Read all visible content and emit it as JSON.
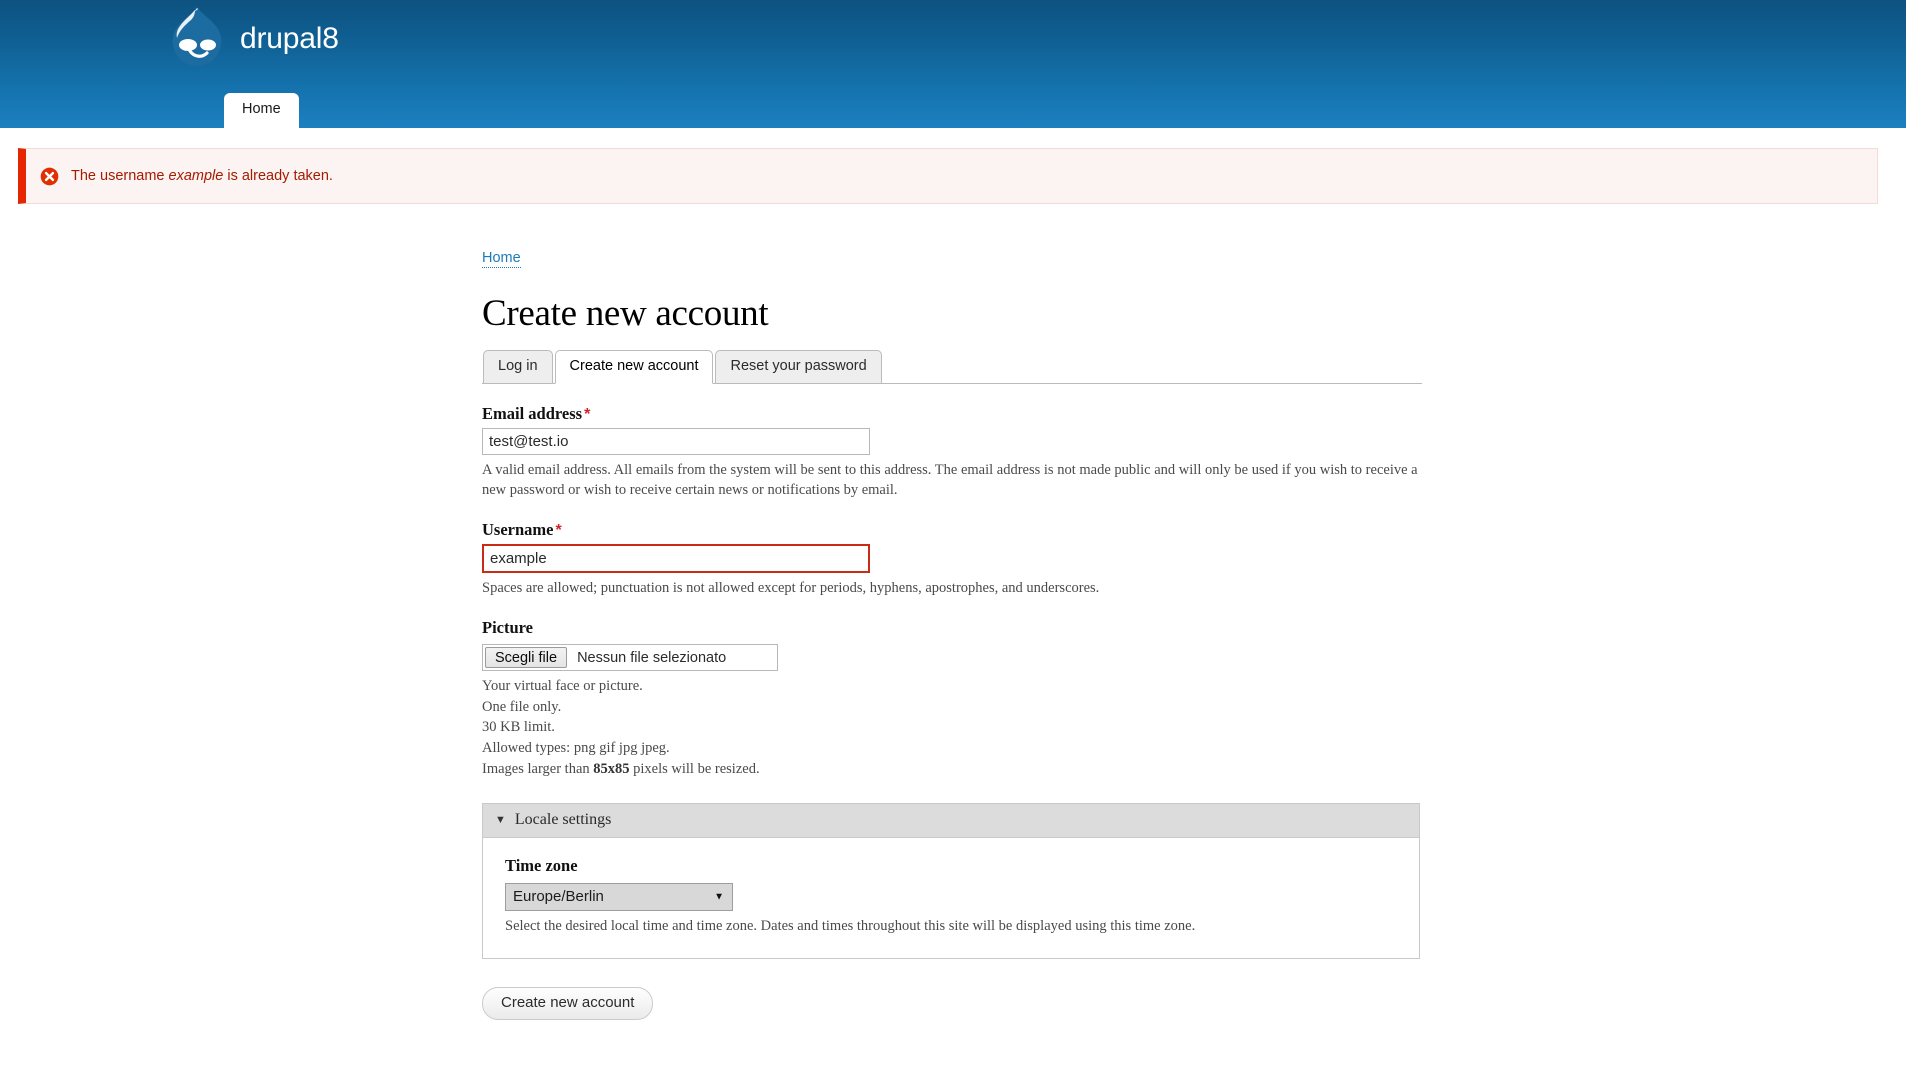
{
  "header": {
    "site_name": "drupal8",
    "logo_icon": "drupal-droplet-icon",
    "menu": [
      {
        "label": "Home",
        "active": true
      }
    ]
  },
  "messages": {
    "error": {
      "icon": "error-circle-x-icon",
      "text_before": "The username ",
      "emphasis": "example",
      "text_after": " is already taken."
    }
  },
  "breadcrumb": {
    "items": [
      {
        "label": "Home",
        "href": "#"
      }
    ]
  },
  "page": {
    "title": "Create new account"
  },
  "tabs": [
    {
      "label": "Log in",
      "active": false
    },
    {
      "label": "Create new account",
      "active": true
    },
    {
      "label": "Reset your password",
      "active": false
    }
  ],
  "form": {
    "email": {
      "label": "Email address",
      "required_mark": "*",
      "value": "test@test.io",
      "placeholder": "",
      "description": "A valid email address. All emails from the system will be sent to this address. The email address is not made public and will only be used if you wish to receive a new password or wish to receive certain news or notifications by email."
    },
    "username": {
      "label": "Username",
      "required_mark": "*",
      "value": "example",
      "placeholder": "",
      "description": "Spaces are allowed; punctuation is not allowed except for periods, hyphens, apostrophes, and underscores.",
      "error_border_color": "#c92b14"
    },
    "picture": {
      "label": "Picture",
      "file_button_label": "Scegli file",
      "file_placeholder": "Nessun file selezionato",
      "descriptions": [
        "Your virtual face or picture.",
        "One file only.",
        "30 KB limit.",
        "Allowed types: png gif jpg jpeg."
      ],
      "resize_note_prefix": "Images larger than ",
      "resize_note_bold": "85x85",
      "resize_note_suffix": " pixels will be resized."
    },
    "locale_settings": {
      "summary": "Locale settings",
      "marker": "▼",
      "timezone": {
        "label": "Time zone",
        "value": "Europe/Berlin",
        "arrow": "▼",
        "options": [
          "Europe/Berlin"
        ],
        "description": "Select the desired local time and time zone. Dates and times throughout this site will be displayed using this time zone."
      }
    },
    "submit": {
      "label": "Create new account"
    }
  },
  "colors": {
    "header_top": "#0e5280",
    "header_bottom": "#1c80c0",
    "error_bar": "#e62600",
    "error_bg": "#fcf4f2",
    "error_text": "#a51b00",
    "link": "#1f7bb6",
    "required": "#d0242a"
  }
}
